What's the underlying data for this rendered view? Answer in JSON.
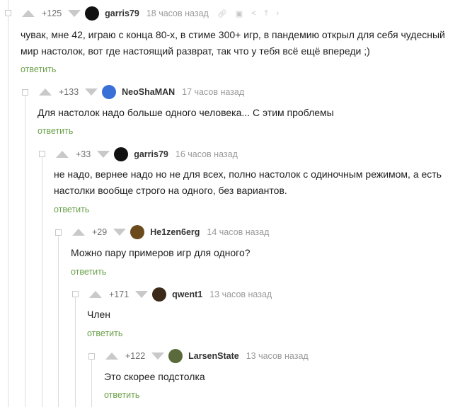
{
  "comments": [
    {
      "rating": "+125",
      "author": "garris79",
      "time": "18 часов назад",
      "text": "чувак, мне 42, играю с конца 80-х, в стиме 300+ игр, в пандемию открыл для себя чудесный мир настолок, вот где настоящий разврат, так что у тебя всё ещё впереди ;)",
      "reply": "ответить",
      "avatar_color": "#111111"
    },
    {
      "rating": "+133",
      "author": "NeoShaMAN",
      "time": "17 часов назад",
      "text": "Для настолок надо больше одного человека... С этим проблемы",
      "reply": "ответить",
      "avatar_color": "#3a6fd8"
    },
    {
      "rating": "+33",
      "author": "garris79",
      "time": "16 часов назад",
      "text": "не надо, вернее надо но не для всех, полно настолок с одиночным режимом, а есть настолки вообще строго на одного, без вариантов.",
      "reply": "ответить",
      "avatar_color": "#111111"
    },
    {
      "rating": "+29",
      "author": "He1zen6erg",
      "time": "14 часов назад",
      "text": "Можно пару примеров игр для одного?",
      "reply": "ответить",
      "avatar_color": "#6b4a1c"
    },
    {
      "rating": "+171",
      "author": "qwent1",
      "time": "13 часов назад",
      "text": "Член",
      "reply": "ответить",
      "avatar_color": "#3b2a1a"
    },
    {
      "rating": "+122",
      "author": "LarsenState",
      "time": "13 часов назад",
      "text": "Это скорее подстолка",
      "reply": "ответить",
      "avatar_color": "#5a6a3a"
    }
  ],
  "toolbar_icons": [
    "link-icon",
    "save-icon",
    "share-icon",
    "pin-top-icon",
    "more-icon"
  ],
  "colors": {
    "reply": "#6aa04a",
    "vote_arrow": "#c9c9c9",
    "rail": "#dcdcdc"
  }
}
